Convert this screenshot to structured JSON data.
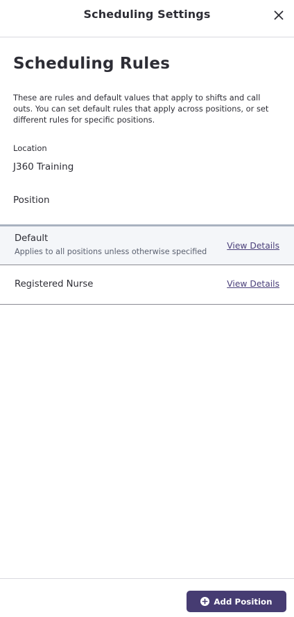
{
  "header": {
    "title": "Scheduling Settings",
    "close_icon": "close-icon"
  },
  "main": {
    "title": "Scheduling Rules",
    "description": "These are rules and default values that apply to shifts and call outs. You can set default rules that apply across positions, or set different rules for specific positions.",
    "location_label": "Location",
    "location_value": "J360 Training",
    "position_section_label": "Position"
  },
  "positions": [
    {
      "name": "Default",
      "subtitle": "Applies to all positions unless otherwise specified",
      "link_label": "View Details",
      "highlighted": true
    },
    {
      "name": "Registered Nurse",
      "subtitle": "",
      "link_label": "View Details",
      "highlighted": false
    }
  ],
  "footer": {
    "add_button_label": "Add Position",
    "add_icon": "plus-circle-icon"
  },
  "colors": {
    "accent": "#463c72",
    "link": "#4a3f7a",
    "highlight_bg": "#f4f6f9"
  }
}
